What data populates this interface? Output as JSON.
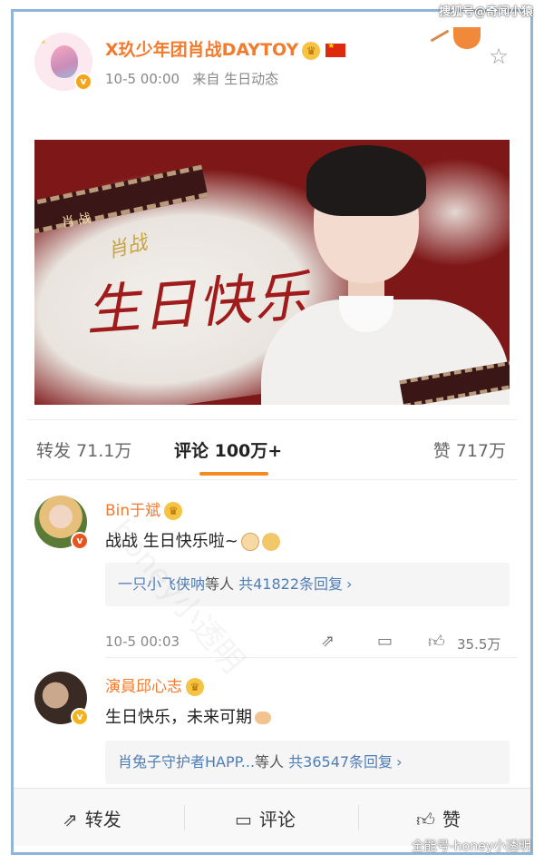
{
  "watermarks": {
    "top": "搜狐号@奇闻小猿",
    "bottom": "全能号-honey小透明",
    "diagonal": "honey小透明"
  },
  "post": {
    "author_name": "X玖少年团肖战DAYTOY",
    "time": "10-5 00:00",
    "source": "来自 生日动态",
    "vip_badge_icon": "crown-icon",
    "country_icon": "china-flag-icon",
    "star_icon": "star-outline-icon",
    "banner": {
      "tag": "肖战",
      "signature": "肖战",
      "greeting": "生日快乐"
    }
  },
  "tabs": {
    "repost": "转发 71.1万",
    "comments": "评论 100万+",
    "likes": "赞 717万"
  },
  "comments": [
    {
      "name": "Bin于斌",
      "text": "战战 生日快乐啦~",
      "reply_user": "一只小飞侠呐",
      "reply_mid": "等人",
      "reply_count": "共41822条回复",
      "time": "10-5 00:03",
      "like_count": "35.5万"
    },
    {
      "name": "演員邱心志",
      "text": "生日快乐，未来可期",
      "reply_user": "肖兔子守护者HAPP...",
      "reply_mid": "等人",
      "reply_count": "共36547条回复"
    }
  ],
  "bottom_bar": {
    "repost": "转发",
    "comment": "评论",
    "like": "赞"
  },
  "colors": {
    "accent_orange": "#f58a20",
    "name_orange": "#f27b2e",
    "link_blue": "#4f7db5",
    "frame_blue": "#8fb6d8"
  }
}
